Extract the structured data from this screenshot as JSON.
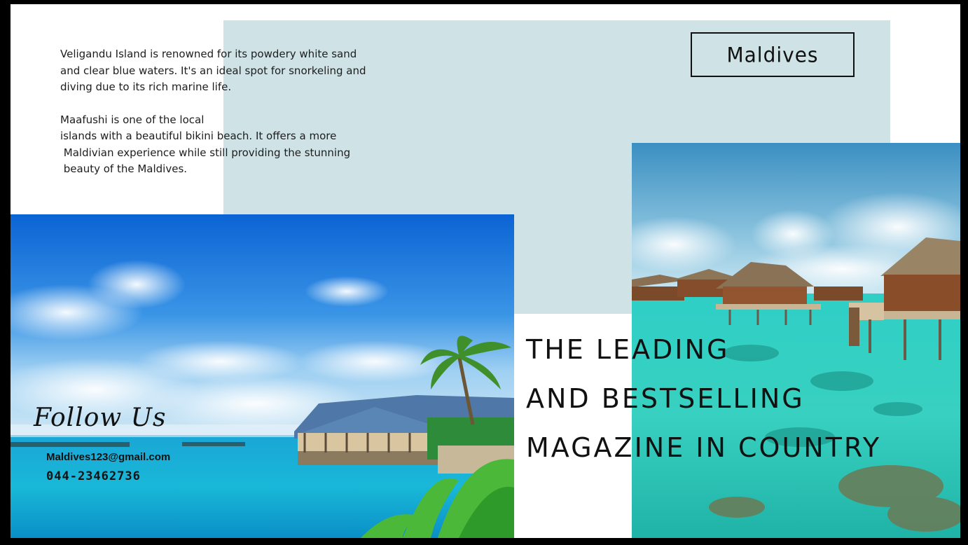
{
  "intro": {
    "paragraph1": [
      "Veligandu Island is renowned for its powdery white sand",
      "and clear blue waters. It's an ideal spot for snorkeling and",
      "diving due to its rich marine life."
    ],
    "paragraph2": [
      "Maafushi is one of the local",
      "islands with a beautiful bikini beach. It offers a more",
      " Maldivian experience while still providing the stunning",
      " beauty of the Maldives."
    ]
  },
  "title_box": {
    "label": "Maldives"
  },
  "headline": {
    "lines": [
      "THE LEADING",
      "AND BESTSELLING",
      "MAGAZINE IN COUNTRY"
    ]
  },
  "contact": {
    "heading": "Follow Us",
    "email": "Maldives123@gmail.com",
    "phone": "044-23462736"
  },
  "images": {
    "left_photo": "tropical-beach-resort-photo",
    "right_photo": "overwater-bungalows-photo"
  },
  "colors": {
    "panel_blue": "#cfe3e7",
    "frame": "#000000",
    "text": "#111111"
  }
}
